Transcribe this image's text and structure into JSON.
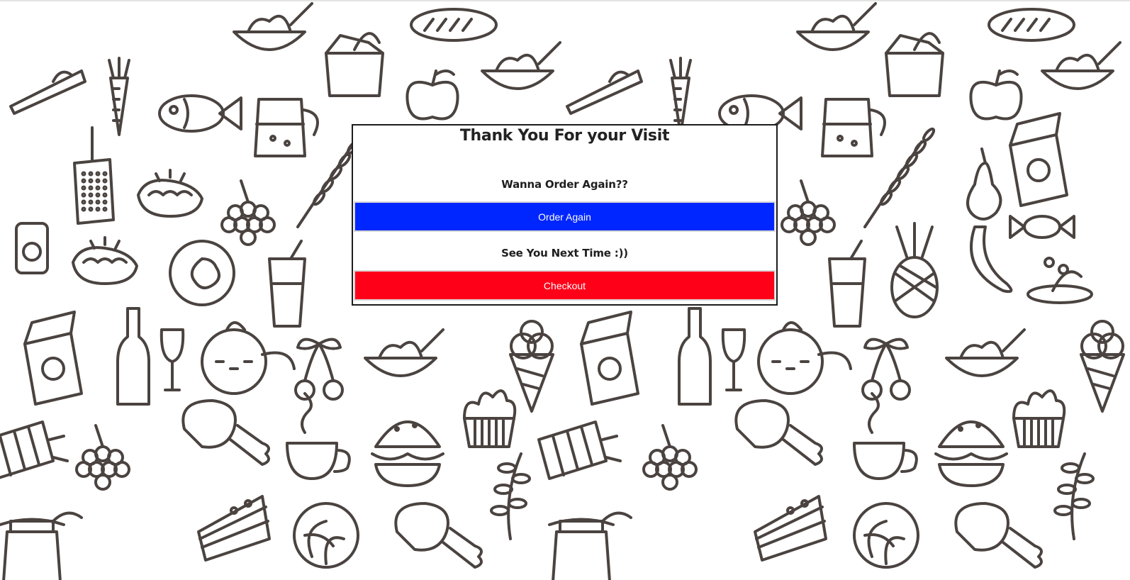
{
  "page": {
    "background_pattern": "food-doodle-pattern",
    "line_color": "#4a4340"
  },
  "dialog": {
    "title": "Thank You For your Visit",
    "order_prompt": "Wanna Order Again??",
    "order_button_label": "Order Again",
    "order_button_color": "#0026ff",
    "checkout_prompt": "See You Next Time :))",
    "checkout_button_label": "Checkout",
    "checkout_button_color": "#ff0019"
  },
  "background_icons": [
    "ice-cream-icon",
    "cherry-icon",
    "burger-icon",
    "wine-bottle-icon",
    "glass-icon",
    "fish-icon",
    "carrot-icon",
    "pie-slice-icon",
    "bread-icon",
    "jug-icon",
    "pineapple-icon",
    "cupcake-icon",
    "chicken-leg-icon",
    "teacup-icon",
    "banana-icon",
    "apple-icon",
    "bowl-icon"
  ]
}
